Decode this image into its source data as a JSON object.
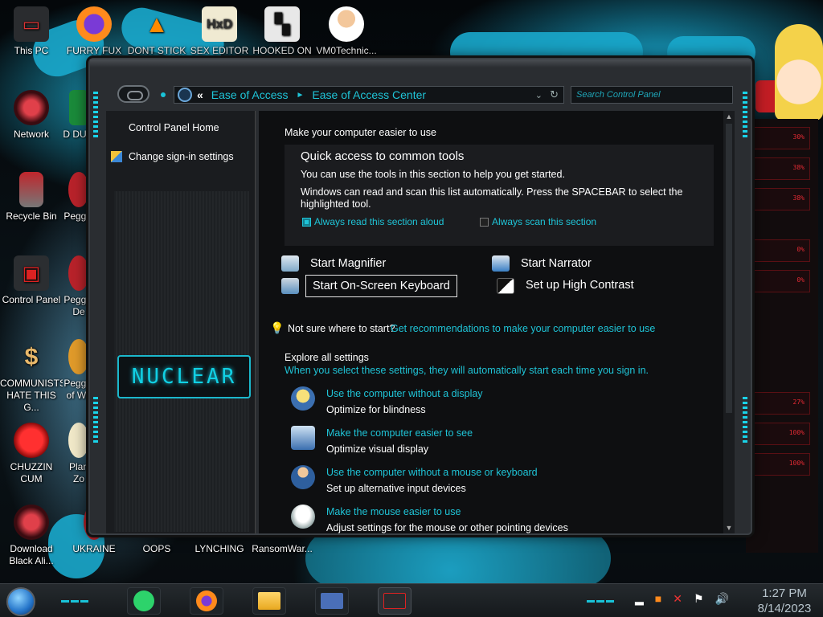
{
  "desktop": {
    "icons": [
      {
        "label": "This PC"
      },
      {
        "label": "FURRY FUX"
      },
      {
        "label": "DONT STICK"
      },
      {
        "label": "SEX EDITOR"
      },
      {
        "label": "HOOKED ON"
      },
      {
        "label": "VM0Technic..."
      },
      {
        "label": "Network"
      },
      {
        "label": "D DUM"
      },
      {
        "label": "Recycle Bin"
      },
      {
        "label": "Peggle"
      },
      {
        "label": "Control Panel"
      },
      {
        "label": "Peggle De"
      },
      {
        "label": "COMMUNISTS HATE THIS G..."
      },
      {
        "label": "Peggle of Wa"
      },
      {
        "label": "CHUZZIN CUM"
      },
      {
        "label": "Plan Zo"
      },
      {
        "label": "Download Black Ali..."
      },
      {
        "label": "UKRAINE"
      },
      {
        "label": "OOPS"
      },
      {
        "label": "LYNCHING"
      },
      {
        "label": "RansomWar..."
      }
    ]
  },
  "window": {
    "address": {
      "back_glyph": "«",
      "crumbs": [
        "Ease of Access",
        "Ease of Access Center"
      ],
      "separator_glyph": "►",
      "dropdown_glyph": "⌄",
      "refresh_glyph": "↻"
    },
    "search": {
      "placeholder": "Search Control Panel"
    },
    "sidebar": {
      "home_label": "Control Panel Home",
      "signin_label": "Change sign-in settings",
      "logo_text": "NUCLEAR"
    },
    "main": {
      "heading": "Make your computer easier to use",
      "quick": {
        "title": "Quick access to common tools",
        "line1": "You can use the tools in this section to help you get started.",
        "line2": "Windows can read and scan this list automatically.  Press the SPACEBAR to select the",
        "line3": "highlighted tool.",
        "check1": {
          "label": "Always read this section aloud",
          "checked": true
        },
        "check2": {
          "label": "Always scan this section",
          "checked": false
        }
      },
      "tools": {
        "magnifier": "Start Magnifier",
        "narrator": "Start Narrator",
        "keyboard": "Start On-Screen Keyboard",
        "contrast": "Set up High Contrast"
      },
      "hint": {
        "prefix": "Not sure where to start?",
        "link": "Get recommendations to make your computer easier to use"
      },
      "explore": {
        "title": "Explore all settings",
        "subtitle": "When you select these settings, they will automatically start each time you sign in.",
        "options": [
          {
            "link": "Use the computer without a display",
            "desc": "Optimize for blindness"
          },
          {
            "link": "Make the computer easier to see",
            "desc": "Optimize visual display"
          },
          {
            "link": "Use the computer without a mouse or keyboard",
            "desc": "Set up alternative input devices"
          },
          {
            "link": "Make the mouse easier to use",
            "desc": "Adjust settings for the mouse or other pointing devices"
          }
        ]
      }
    }
  },
  "right_panel": {
    "values": [
      "30%",
      "38%",
      "38%",
      "0%",
      "0%",
      "27%",
      "100%",
      "100%"
    ]
  },
  "taskbar": {
    "clock_time": "1:27 PM",
    "clock_date": "8/14/2023"
  },
  "colors": {
    "accent": "#1fc4d7",
    "window_bg": "#0e0f11",
    "wallpaper_cyan": "#1aa9cc"
  }
}
